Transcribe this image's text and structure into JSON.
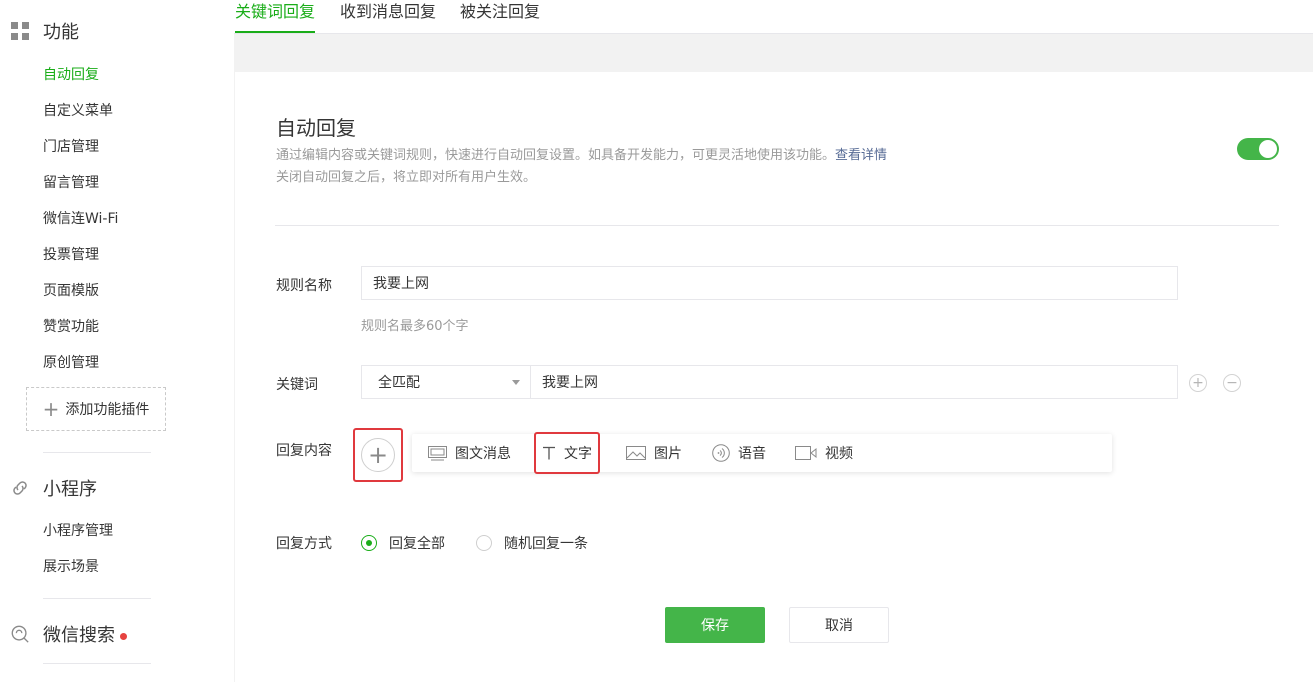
{
  "colors": {
    "accent": "#1aad19",
    "highlight": "#e0393e",
    "link": "#576b95"
  },
  "sidebar": {
    "func_title": "功能",
    "func_icon": "grid-icon",
    "items": [
      {
        "label": "自动回复",
        "active": true
      },
      {
        "label": "自定义菜单"
      },
      {
        "label": "门店管理"
      },
      {
        "label": "留言管理"
      },
      {
        "label": "微信连Wi-Fi"
      },
      {
        "label": "投票管理"
      },
      {
        "label": "页面模版"
      },
      {
        "label": "赞赏功能"
      },
      {
        "label": "原创管理"
      }
    ],
    "add_plugin": "添加功能插件",
    "mini_title": "小程序",
    "mini_icon": "link-icon",
    "mini_items": [
      {
        "label": "小程序管理"
      },
      {
        "label": "展示场景"
      }
    ],
    "search_title": "微信搜索",
    "search_icon": "search-icon"
  },
  "tabs": [
    {
      "label": "关键词回复",
      "active": true
    },
    {
      "label": "收到消息回复"
    },
    {
      "label": "被关注回复"
    }
  ],
  "panel": {
    "title": "自动回复",
    "desc": "通过编辑内容或关键词规则，快速进行自动回复设置。如具备开发能力，可更灵活地使用该功能。",
    "desc_link": "查看详情",
    "desc2": "关闭自动回复之后，将立即对所有用户生效。",
    "toggle_on": true,
    "rule_label": "规则名称",
    "rule_value": "我要上网",
    "rule_hint": "规则名最多60个字",
    "keyword_label": "关键词",
    "match_value": "全匹配",
    "keyword_value": "我要上网",
    "reply_label": "回复内容",
    "reply_types": [
      {
        "label": "图文消息",
        "icon": "news-icon"
      },
      {
        "label": "文字",
        "icon": "text-icon"
      },
      {
        "label": "图片",
        "icon": "image-icon"
      },
      {
        "label": "语音",
        "icon": "voice-icon"
      },
      {
        "label": "视频",
        "icon": "video-icon"
      }
    ],
    "method_label": "回复方式",
    "methods": [
      {
        "label": "回复全部",
        "checked": true
      },
      {
        "label": "随机回复一条",
        "checked": false
      }
    ],
    "save": "保存",
    "cancel": "取消"
  }
}
